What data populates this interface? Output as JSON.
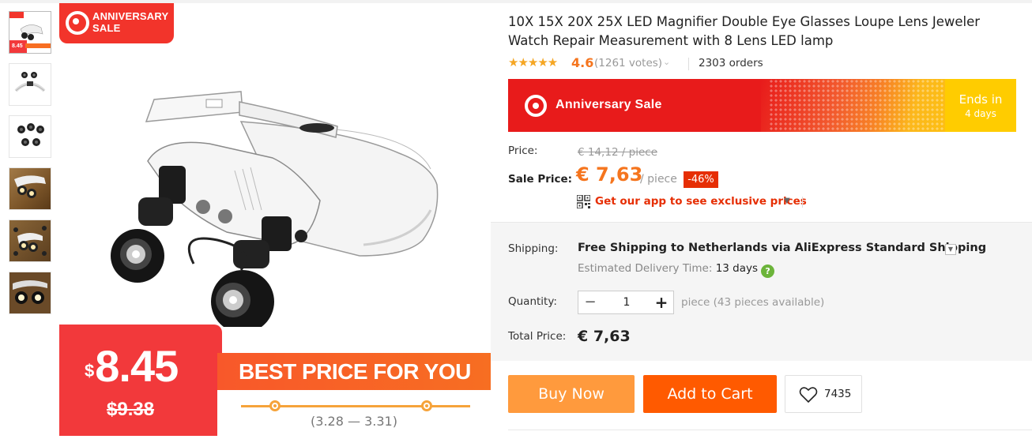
{
  "gallery": {
    "thumbnails": [
      {
        "name": "thumb-1",
        "mini_price": "8.45"
      },
      {
        "name": "thumb-2"
      },
      {
        "name": "thumb-3"
      },
      {
        "name": "thumb-4"
      },
      {
        "name": "thumb-5"
      },
      {
        "name": "thumb-6"
      }
    ],
    "badge": {
      "line1": "ANNIVERSARY",
      "line2": "SALE"
    },
    "promo": {
      "price_symbol": "$",
      "price": "8.45",
      "old_price": "$9.38",
      "slogan": "BEST PRICE FOR YOU",
      "dates": "(3.28 — 3.31)"
    }
  },
  "product": {
    "title": "10X 15X 20X 25X LED Magnifier Double Eye Glasses Loupe Lens Jeweler Watch Repair Measurement with 8 Lens LED lamp",
    "stars": "★★★★★",
    "rating": "4.6",
    "votes": "(1261 votes)",
    "orders": "2303 orders"
  },
  "banner": {
    "label": "Anniversary Sale",
    "ends_label": "Ends in",
    "ends_value": "4 days"
  },
  "price": {
    "label": "Price:",
    "original": "€ 14,12 / piece",
    "sale_label": "Sale Price:",
    "sale_value": "€ 7,63",
    "per": "/ piece",
    "discount": "-46%",
    "app_link": "Get our app to see exclusive prices"
  },
  "shipping": {
    "label": "Shipping:",
    "value": "Free Shipping to Netherlands via AliExpress Standard Shipping",
    "estimate_label": "Estimated Delivery Time:",
    "estimate_value": "13 days"
  },
  "quantity": {
    "label": "Quantity:",
    "value": "1",
    "note": "piece (43 pieces available)"
  },
  "total": {
    "label": "Total Price:",
    "value": "€ 7,63"
  },
  "actions": {
    "buy_now": "Buy Now",
    "add_to_cart": "Add to Cart",
    "wishlist_count": "7435"
  },
  "colors": {
    "accent_orange": "#ff5a00",
    "buy_now_orange": "#ff9a3d",
    "sale_red": "#e62e04",
    "banner_red": "#e81b1b",
    "banner_yellow": "#ffcc00"
  }
}
